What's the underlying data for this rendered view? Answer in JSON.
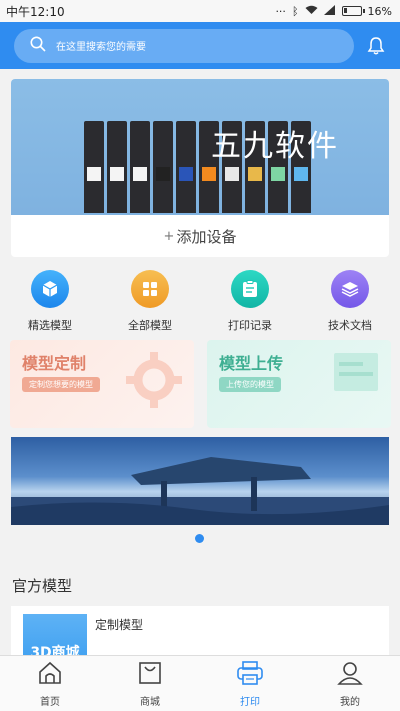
{
  "status_bar": {
    "time": "中午12:10",
    "battery": "16%"
  },
  "header": {
    "search_placeholder": "在这里搜索您的需要"
  },
  "banner": {
    "title": "五九软件",
    "add_device_label": "添加设备"
  },
  "categories": [
    {
      "label": "精选模型",
      "icon": "cube-icon",
      "color": "#2b9af3"
    },
    {
      "label": "全部模型",
      "icon": "grid-icon",
      "color": "#f2a93b"
    },
    {
      "label": "打印记录",
      "icon": "clipboard-icon",
      "color": "#1cc7b5"
    },
    {
      "label": "技术文档",
      "icon": "layers-icon",
      "color": "#8a6df0"
    }
  ],
  "promos": [
    {
      "title": "模型定制",
      "subtitle": "定制您想要的模型"
    },
    {
      "title": "模型上传",
      "subtitle": "上传您的模型"
    }
  ],
  "official": {
    "section_title": "官方模型",
    "items": [
      {
        "name": "定制模型",
        "thumb_label": "3D商城"
      }
    ]
  },
  "tabbar": {
    "tabs": [
      {
        "label": "首页",
        "icon": "home-icon"
      },
      {
        "label": "商城",
        "icon": "shopping-bag-icon"
      },
      {
        "label": "打印",
        "icon": "printer-icon",
        "active": true
      },
      {
        "label": "我的",
        "icon": "user-icon"
      }
    ]
  },
  "colors": {
    "primary": "#2f8cf0"
  }
}
